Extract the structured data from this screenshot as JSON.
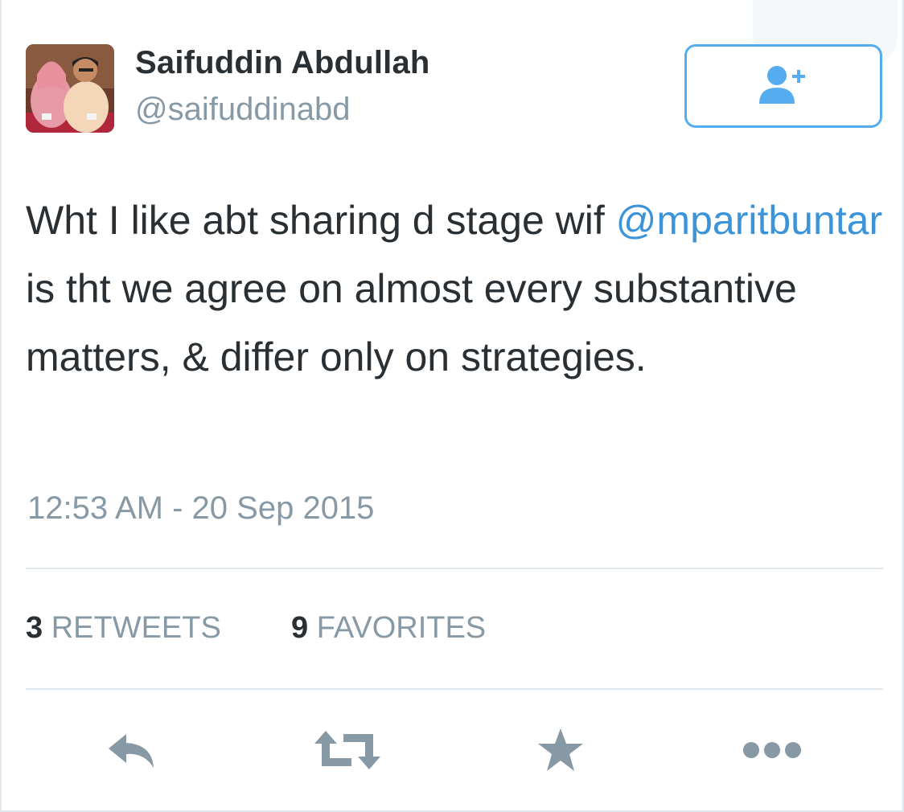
{
  "tweet": {
    "author": {
      "name": "Saifuddin Abdullah",
      "handle": "@saifuddinabd"
    },
    "follow_button_icon": "add-user-icon",
    "text_before": "Wht I like abt sharing d stage wif ",
    "mention": "@mparitbuntar",
    "text_after": " is tht we agree on almost every substantive matters, & differ only on strategies.",
    "timestamp": "12:53 AM - 20 Sep 2015",
    "stats": {
      "retweets_count": "3",
      "retweets_label": "RETWEETS",
      "favorites_count": "9",
      "favorites_label": "FAVORITES"
    },
    "actions": [
      "reply-icon",
      "retweet-icon",
      "favorite-star-icon",
      "more-icon"
    ]
  },
  "colors": {
    "text": "#292f33",
    "secondary": "#8899a6",
    "link": "#3b94d9",
    "accent": "#55acee",
    "icon": "#8899a6",
    "divider": "#e1e8ed"
  }
}
